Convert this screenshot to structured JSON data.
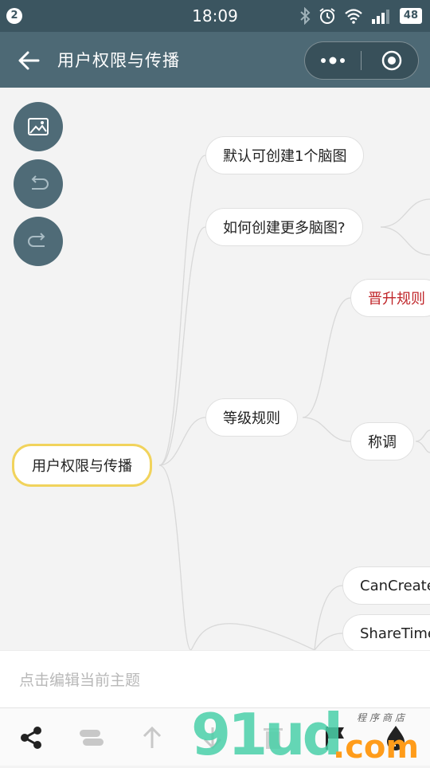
{
  "status_bar": {
    "notification_count": "2",
    "time": "18:09",
    "battery": "48"
  },
  "nav": {
    "title": "用户权限与传播"
  },
  "mindmap": {
    "root": "用户权限与传播",
    "nodes": {
      "default_create": "默认可创建1个脑图",
      "how_more": "如何创建更多脑图?",
      "upgrade_rules": "晋升规则",
      "level_rules": "等级规则",
      "title": "称调",
      "can_create": "CanCreate",
      "share_time": "ShareTime"
    }
  },
  "editor": {
    "placeholder": "点击编辑当前主题"
  },
  "watermark": {
    "brand": "91ud",
    "tld": ".com",
    "subtitle": "程序商店"
  },
  "colors": {
    "header": "#4d6975",
    "status_bar": "#3b5560",
    "root_border": "#f1d35c",
    "highlight_text": "#c0262a",
    "watermark_green": "#4bd0a9",
    "watermark_orange": "#ff9c1a"
  }
}
